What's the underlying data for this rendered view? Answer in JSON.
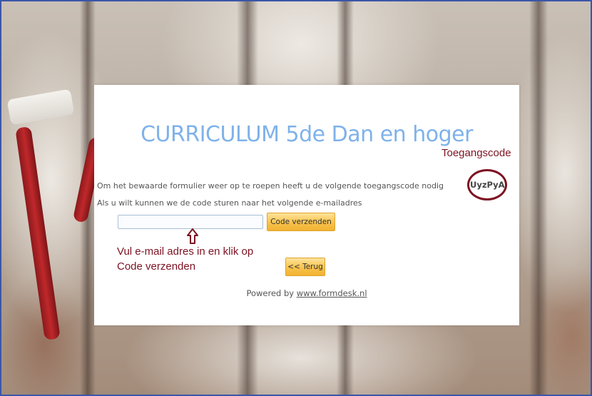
{
  "form": {
    "title": "CURRICULUM 5de Dan en hoger",
    "retrieve_text": "Om het bewaarde formulier weer op te roepen heeft u de volgende toegangscode nodig",
    "access_code": "UyzPyA",
    "email_text": "Als u wilt kunnen we de code sturen naar het volgende e-mailadres",
    "email_value": "",
    "send_button": "Code verzenden",
    "back_button": "<< Terug",
    "powered_prefix": "Powered by",
    "powered_link": "www.formdesk.nl"
  },
  "annotations": {
    "access_code_label": "Toegangscode",
    "instruction_line1": "Vul e-mail adres in en klik op",
    "instruction_line2": "Code verzenden",
    "color": "#7d1222"
  },
  "colors": {
    "title": "#7fb2ea",
    "button": "#f8c24b",
    "frame_border": "#3a56a8"
  }
}
